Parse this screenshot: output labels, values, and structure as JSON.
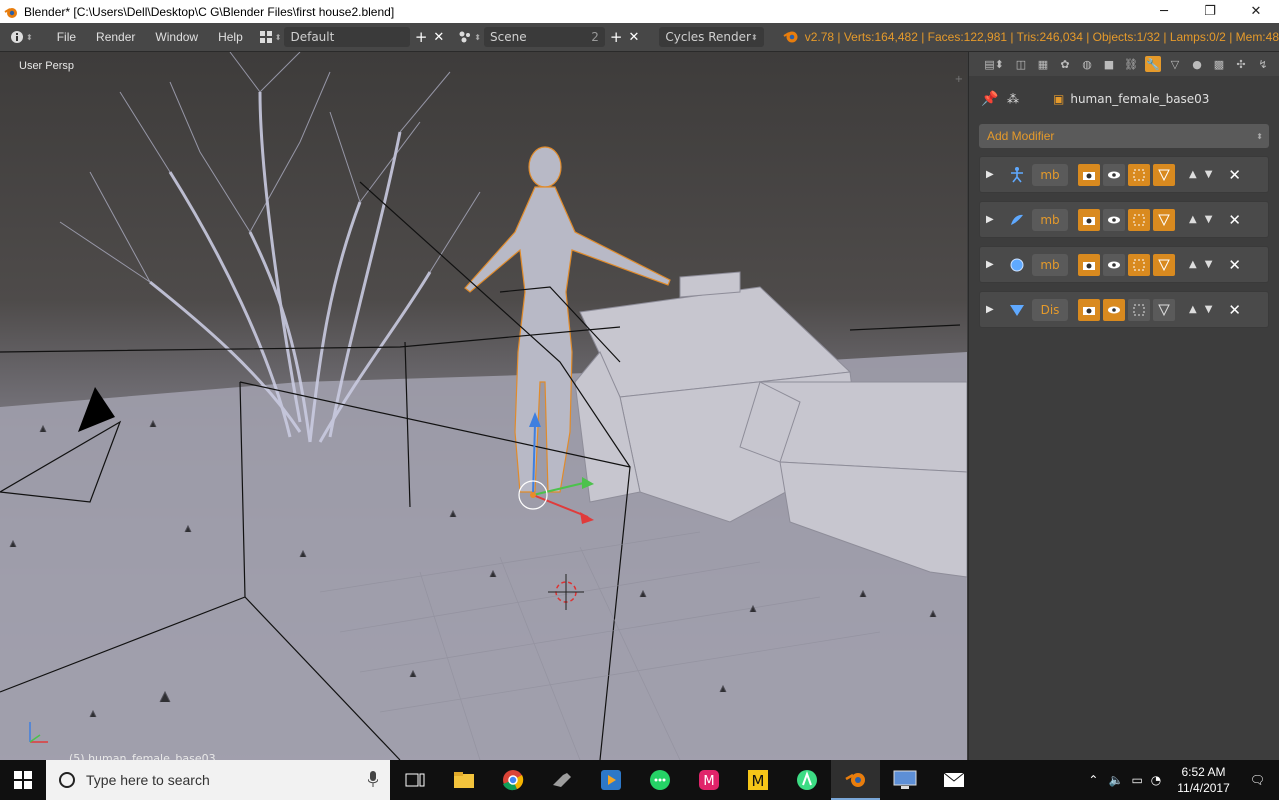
{
  "window": {
    "title": "Blender* [C:\\Users\\Dell\\Desktop\\C G\\Blender Files\\first house2.blend]",
    "minimize": "─",
    "restore": "❐",
    "close": "✕"
  },
  "menubar": {
    "info_icon": "info-icon",
    "menus": [
      "File",
      "Render",
      "Window",
      "Help"
    ],
    "layout": "Default",
    "scene": "Scene",
    "scene_count": "2",
    "engine": "Cycles Render",
    "stats": "v2.78 | Verts:164,482 | Faces:122,981 | Tris:246,034 | Objects:1/32 | Lamps:0/2 | Mem:48"
  },
  "viewport": {
    "view_label": "User Persp",
    "object_label": "(5) human_female_base03"
  },
  "properties": {
    "object_name": "human_female_base03",
    "add_modifier": "Add Modifier",
    "modifiers": [
      {
        "icon": "armature-icon",
        "name": "mb",
        "edit_on": true,
        "cage_on": true
      },
      {
        "icon": "corrective-smooth-icon",
        "name": "mb",
        "edit_on": true,
        "cage_on": true
      },
      {
        "icon": "subdivision-icon",
        "name": "mb",
        "edit_on": true,
        "cage_on": true
      },
      {
        "icon": "displace-icon",
        "name": "Dis",
        "edit_on": false,
        "cage_on": false
      }
    ]
  },
  "taskbar": {
    "search_placeholder": "Type here to search",
    "time": "6:52 AM",
    "date": "11/4/2017",
    "apps": [
      "task-view-icon",
      "file-explorer-icon",
      "chrome-icon",
      "tools-icon",
      "media-player-icon",
      "whatsapp-icon",
      "app-m-pink-icon",
      "app-m-yellow-icon",
      "android-studio-icon",
      "blender-icon",
      "remote-desktop-icon",
      "mail-icon"
    ]
  },
  "colors": {
    "accent": "#e59a2b",
    "panel": "#3d3d3d",
    "header": "#474747"
  }
}
